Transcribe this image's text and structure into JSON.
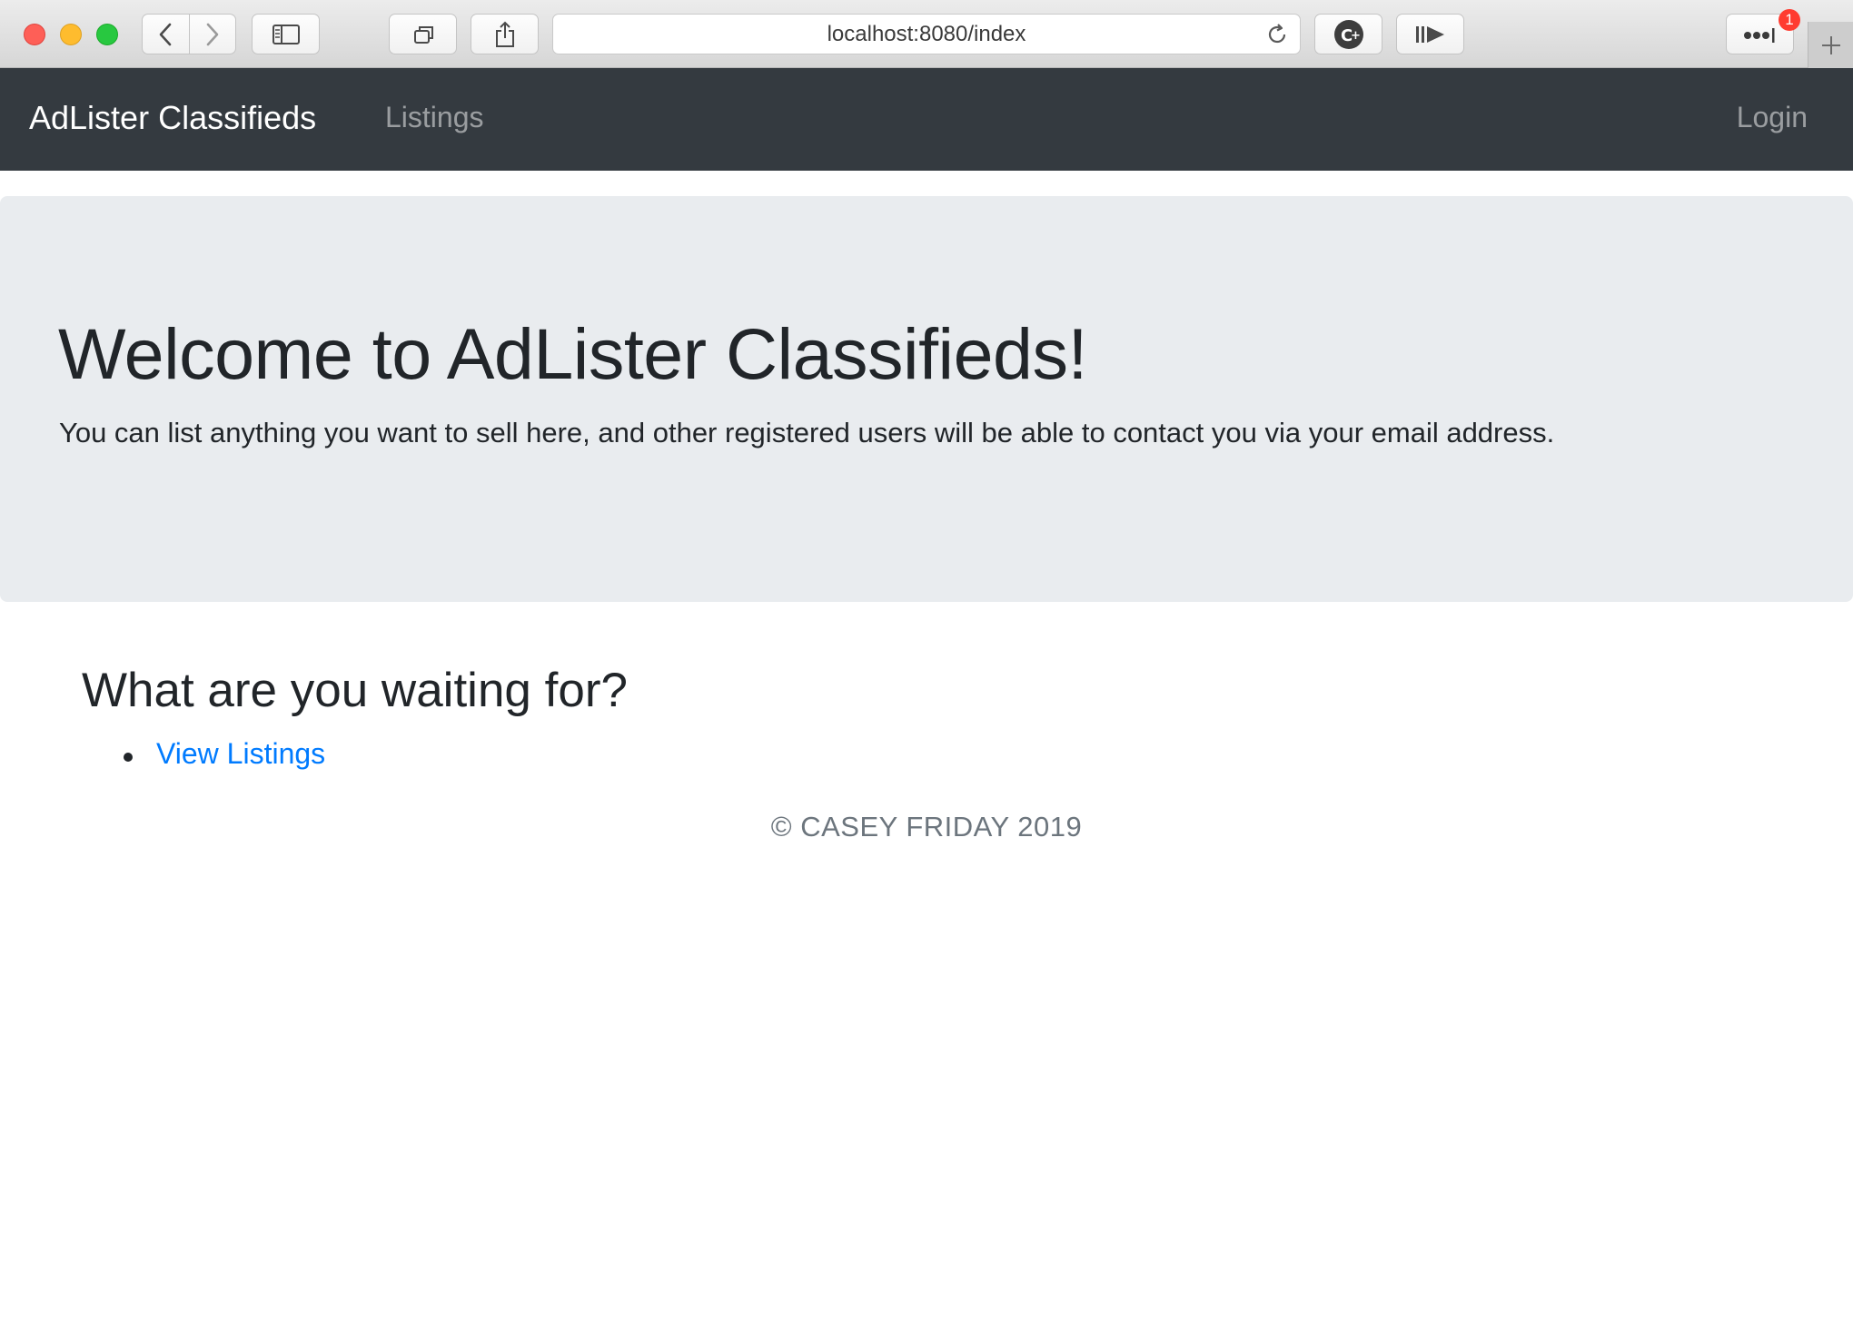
{
  "browser": {
    "url": "localhost:8080/index",
    "notification_count": "1",
    "icons": [
      "back-icon",
      "forward-icon",
      "sidebar-icon",
      "tabs-icon",
      "share-icon",
      "reload-icon",
      "extension-c-plus-icon",
      "reader-play-icon",
      "more-icon",
      "plus-icon"
    ]
  },
  "navbar": {
    "brand": "AdLister Classifieds",
    "listings_label": "Listings",
    "login_label": "Login"
  },
  "jumbotron": {
    "title": "Welcome to AdLister Classifieds!",
    "lead": "You can list anything you want to sell here, and other registered users will be able to contact you via your email address."
  },
  "content": {
    "heading": "What are you waiting for?",
    "links": [
      {
        "label": "View Listings"
      }
    ]
  },
  "footer": {
    "text": "© CASEY FRIDAY 2019"
  },
  "colors": {
    "navbar_bg": "#343a40",
    "jumbotron_bg": "#e9ecef",
    "link": "#007bff",
    "footer_text": "#6c757d"
  }
}
